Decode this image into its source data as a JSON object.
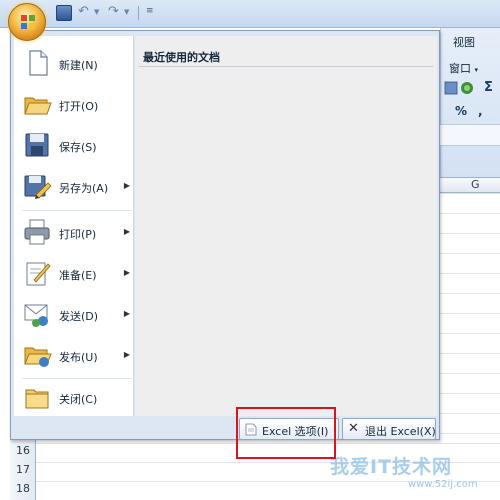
{
  "ribbon": {
    "tab_view": "视图",
    "group_window": "窗口",
    "percent_symbol": "%",
    "sigma_symbol": "Σ",
    "column_label": "G"
  },
  "menu": {
    "items": [
      {
        "label": "新建(N)",
        "icon": "new-document-icon",
        "has_submenu": false
      },
      {
        "label": "打开(O)",
        "icon": "open-folder-icon",
        "has_submenu": false
      },
      {
        "label": "保存(S)",
        "icon": "save-disk-icon",
        "has_submenu": false
      },
      {
        "label": "另存为(A)",
        "icon": "save-as-icon",
        "has_submenu": true
      },
      {
        "label": "打印(P)",
        "icon": "printer-icon",
        "has_submenu": true
      },
      {
        "label": "准备(E)",
        "icon": "prepare-icon",
        "has_submenu": true
      },
      {
        "label": "发送(D)",
        "icon": "send-icon",
        "has_submenu": true
      },
      {
        "label": "发布(U)",
        "icon": "publish-icon",
        "has_submenu": true
      },
      {
        "label": "关闭(C)",
        "icon": "close-folder-icon",
        "has_submenu": false
      }
    ],
    "recent_title": "最近使用的文档",
    "options_button": "Excel 选项(I)",
    "exit_button": "退出 Excel(X)"
  },
  "rows": [
    "16",
    "17",
    "18"
  ],
  "watermark": {
    "text": "我爱IT技术网",
    "url": "www.52ij.com"
  },
  "colors": {
    "highlight": "#d9141b",
    "menu_bg": "#dde7f3",
    "office_orange": "#f6c04a"
  }
}
